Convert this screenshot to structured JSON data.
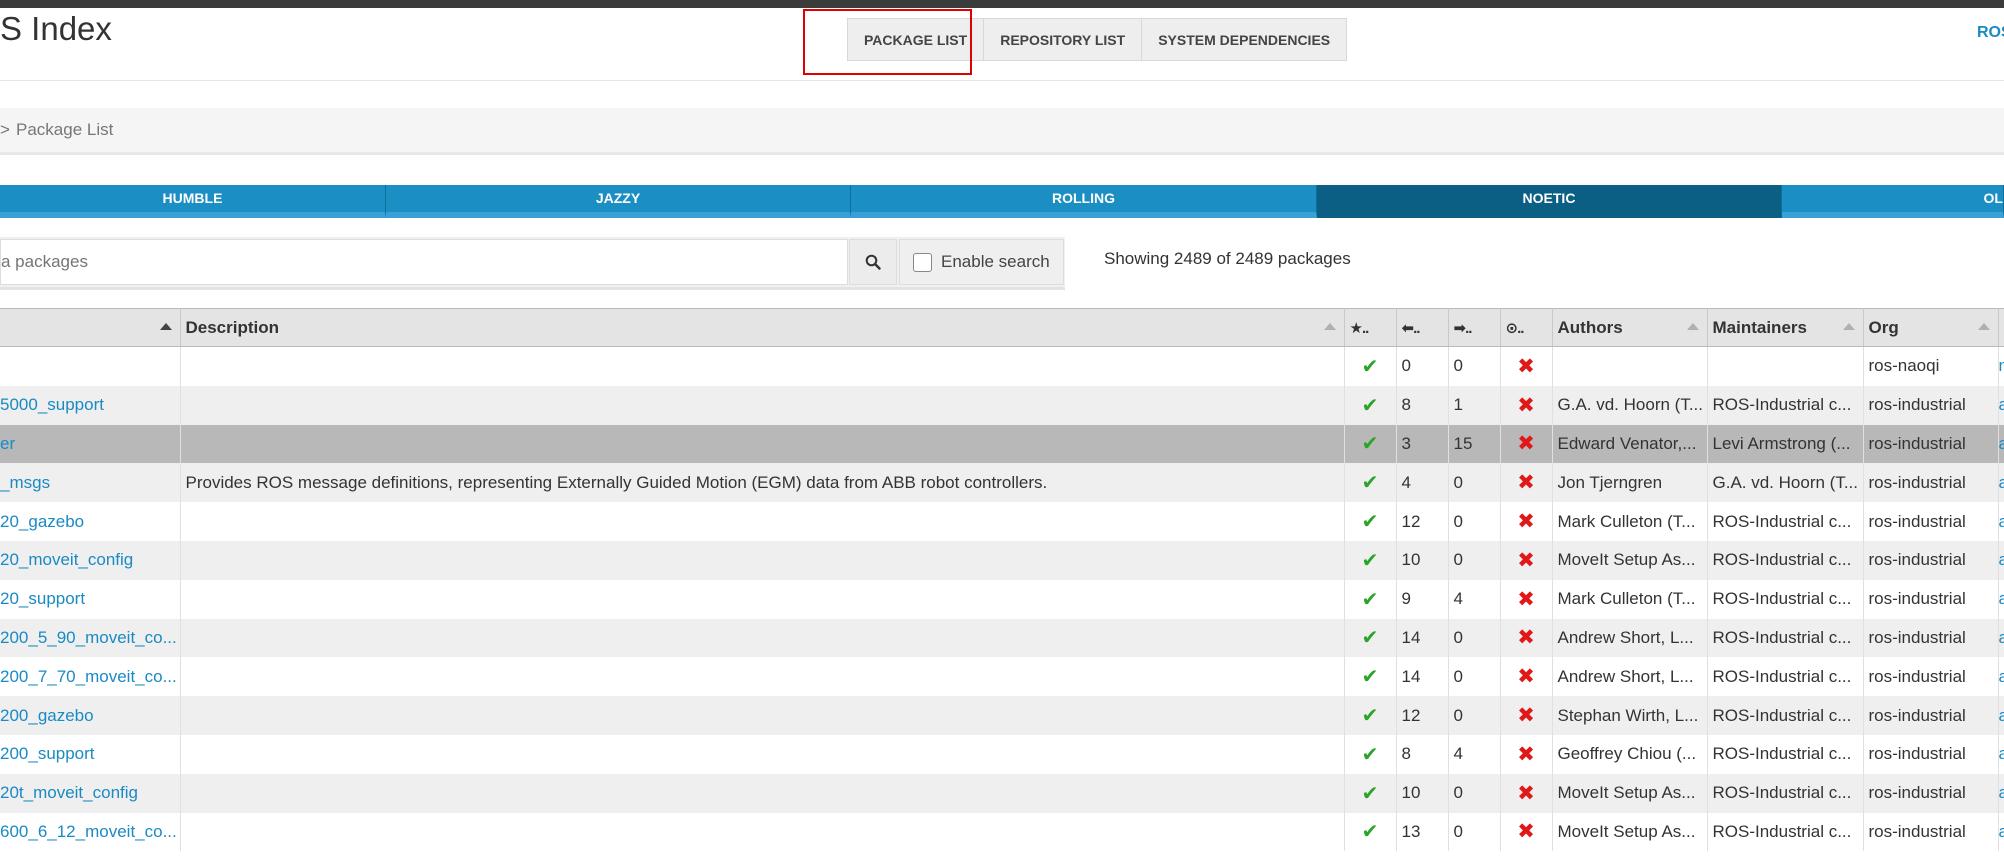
{
  "brand": "S Index",
  "nav": [
    {
      "label": "PACKAGE LIST"
    },
    {
      "label": "REPOSITORY LIST"
    },
    {
      "label": "SYSTEM DEPENDENCIES"
    }
  ],
  "ros_link": "ROS",
  "breadcrumb": {
    "sep": ">",
    "current": "Package List"
  },
  "distros": [
    {
      "label": "HUMBLE"
    },
    {
      "label": "JAZZY"
    },
    {
      "label": "ROLLING"
    },
    {
      "label": "NOETIC"
    },
    {
      "label": "OL"
    }
  ],
  "search": {
    "placeholder": "a packages",
    "enable_label": "Enable search",
    "showing": "Showing 2489 of 2489 packages"
  },
  "table": {
    "headers": {
      "description": "Description",
      "released": "★..",
      "deps": "⬅..",
      "used_by": "➡..",
      "issues": "⊙..",
      "authors": "Authors",
      "maintainers": "Maintainers",
      "org": "Org"
    },
    "rows": [
      {
        "name": "",
        "desc": "",
        "deps": "0",
        "used": "0",
        "authors": "",
        "maint": "",
        "org": "ros-naoqi",
        "extra": "n"
      },
      {
        "name": "5000_support",
        "desc": "",
        "deps": "8",
        "used": "1",
        "authors": "G.A. vd. Hoorn (T...",
        "maint": "ROS-Industrial c...",
        "org": "ros-industrial",
        "extra": "a"
      },
      {
        "name": "er",
        "desc": "",
        "deps": "3",
        "used": "15",
        "authors": "Edward Venator,...",
        "maint": "Levi Armstrong (...",
        "org": "ros-industrial",
        "extra": "a"
      },
      {
        "name": "_msgs",
        "desc": "Provides ROS message definitions, representing Externally Guided Motion (EGM) data from ABB robot controllers.",
        "deps": "4",
        "used": "0",
        "authors": "Jon Tjerngren",
        "maint": "G.A. vd. Hoorn (T...",
        "org": "ros-industrial",
        "extra": "a"
      },
      {
        "name": "20_gazebo",
        "desc": "",
        "deps": "12",
        "used": "0",
        "authors": "Mark Culleton (T...",
        "maint": "ROS-Industrial c...",
        "org": "ros-industrial",
        "extra": "a"
      },
      {
        "name": "20_moveit_config",
        "desc": "",
        "deps": "10",
        "used": "0",
        "authors": "MoveIt Setup As...",
        "maint": "ROS-Industrial c...",
        "org": "ros-industrial",
        "extra": "a"
      },
      {
        "name": "20_support",
        "desc": "",
        "deps": "9",
        "used": "4",
        "authors": "Mark Culleton (T...",
        "maint": "ROS-Industrial c...",
        "org": "ros-industrial",
        "extra": "a"
      },
      {
        "name": "200_5_90_moveit_co...",
        "desc": "",
        "deps": "14",
        "used": "0",
        "authors": "Andrew Short, L...",
        "maint": "ROS-Industrial c...",
        "org": "ros-industrial",
        "extra": "a"
      },
      {
        "name": "200_7_70_moveit_co...",
        "desc": "",
        "deps": "14",
        "used": "0",
        "authors": "Andrew Short, L...",
        "maint": "ROS-Industrial c...",
        "org": "ros-industrial",
        "extra": "a"
      },
      {
        "name": "200_gazebo",
        "desc": "",
        "deps": "12",
        "used": "0",
        "authors": "Stephan Wirth, L...",
        "maint": "ROS-Industrial c...",
        "org": "ros-industrial",
        "extra": "a"
      },
      {
        "name": "200_support",
        "desc": "",
        "deps": "8",
        "used": "4",
        "authors": "Geoffrey Chiou (...",
        "maint": "ROS-Industrial c...",
        "org": "ros-industrial",
        "extra": "a"
      },
      {
        "name": "20t_moveit_config",
        "desc": "",
        "deps": "10",
        "used": "0",
        "authors": "MoveIt Setup As...",
        "maint": "ROS-Industrial c...",
        "org": "ros-industrial",
        "extra": "a"
      },
      {
        "name": "600_6_12_moveit_co...",
        "desc": "",
        "deps": "13",
        "used": "0",
        "authors": "MoveIt Setup As...",
        "maint": "ROS-Industrial c...",
        "org": "ros-industrial",
        "extra": "a"
      }
    ]
  },
  "colors": {
    "accent": "#1b8ec4",
    "active_distro": "#0b5f85",
    "check": "#2aa52a",
    "cross": "#e01818",
    "highlight": "#e00000"
  },
  "icons": {
    "check": "check-icon",
    "cross": "cross-icon",
    "search": "search-icon"
  }
}
